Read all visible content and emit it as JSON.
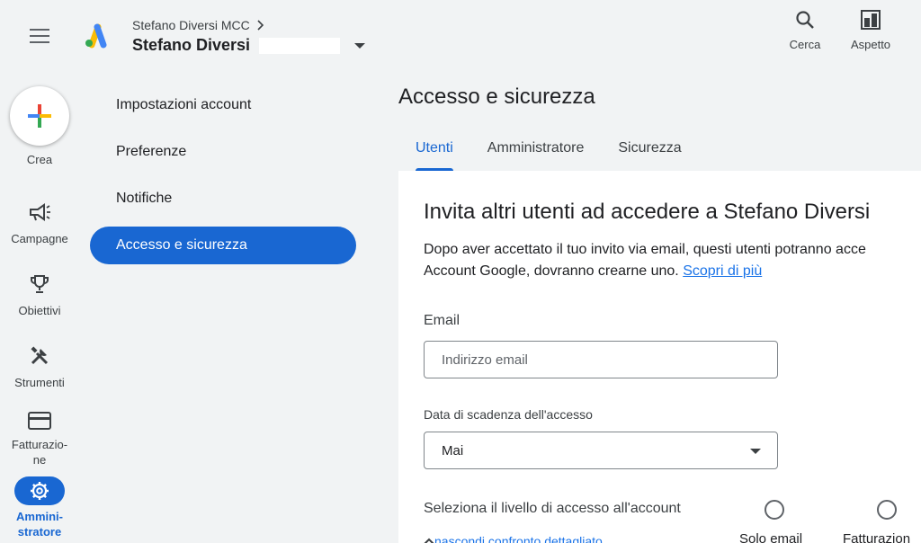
{
  "header": {
    "menu_icon": "menu-icon",
    "logo_icon": "google-ads-logo",
    "parent_account": "Stefano Diversi MCC",
    "account_name": "Stefano Diversi",
    "actions": [
      {
        "label": "Cerca",
        "icon": "search-icon"
      },
      {
        "label": "Aspetto",
        "icon": "appearance-icon"
      }
    ]
  },
  "rail": {
    "create_label": "Crea",
    "items": [
      {
        "label": "Campagne",
        "icon": "megaphone-icon"
      },
      {
        "label": "Obiettivi",
        "icon": "trophy-icon"
      },
      {
        "label": "Strumenti",
        "icon": "tools-icon"
      },
      {
        "label": "Fatturazio-\nne",
        "icon": "credit-card-icon"
      },
      {
        "label": "Ammini-\nstratore",
        "icon": "gear-icon"
      }
    ]
  },
  "subnav": {
    "items": [
      {
        "label": "Impostazioni account"
      },
      {
        "label": "Preferenze"
      },
      {
        "label": "Notifiche"
      },
      {
        "label": "Accesso e sicurezza"
      }
    ]
  },
  "main": {
    "title": "Accesso e sicurezza",
    "tabs": [
      {
        "label": "Utenti"
      },
      {
        "label": "Amministratore"
      },
      {
        "label": "Sicurezza"
      }
    ]
  },
  "invite": {
    "title": "Invita altri utenti ad accedere a Stefano Diversi",
    "desc_line1": "Dopo aver accettato il tuo invito via email, questi utenti potranno acce",
    "desc_line2": "Account Google, dovranno crearne uno.",
    "learn_more": "Scopri di più",
    "email_label": "Email",
    "email_placeholder": "Indirizzo email",
    "expiry_label": "Data di scadenza dell'accesso",
    "expiry_value": "Mai",
    "access_level_label": "Seleziona il livello di accesso all'account",
    "options": [
      {
        "label": "Solo email"
      },
      {
        "label": "Fatturazion"
      }
    ],
    "compare_link": "nascondi confronto dettagliato"
  },
  "colors": {
    "accent": "#1967d2",
    "link": "#1a73e8",
    "background": "#f1f3f4"
  }
}
